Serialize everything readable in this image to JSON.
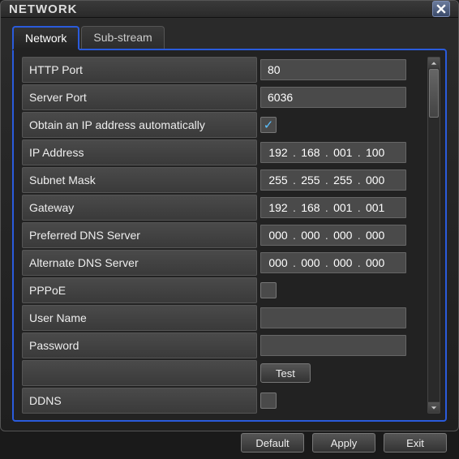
{
  "window": {
    "title": "NETWORK"
  },
  "tabs": [
    {
      "label": "Network",
      "active": true
    },
    {
      "label": "Sub-stream",
      "active": false
    }
  ],
  "fields": {
    "http_port": {
      "label": "HTTP Port",
      "value": "80"
    },
    "server_port": {
      "label": "Server Port",
      "value": "6036"
    },
    "dhcp": {
      "label": "Obtain an IP address automatically",
      "checked": true
    },
    "ip_address": {
      "label": "IP Address",
      "octets": [
        "192",
        "168",
        "001",
        "100"
      ]
    },
    "subnet_mask": {
      "label": "Subnet Mask",
      "octets": [
        "255",
        "255",
        "255",
        "000"
      ]
    },
    "gateway": {
      "label": "Gateway",
      "octets": [
        "192",
        "168",
        "001",
        "001"
      ]
    },
    "pref_dns": {
      "label": "Preferred DNS Server",
      "octets": [
        "000",
        "000",
        "000",
        "000"
      ]
    },
    "alt_dns": {
      "label": "Alternate DNS Server",
      "octets": [
        "000",
        "000",
        "000",
        "000"
      ]
    },
    "pppoe": {
      "label": "PPPoE",
      "checked": false
    },
    "user_name": {
      "label": "User Name",
      "value": ""
    },
    "password": {
      "label": "Password",
      "value": ""
    },
    "test": {
      "label": "",
      "button": "Test"
    },
    "ddns": {
      "label": "DDNS",
      "checked": false
    }
  },
  "buttons": {
    "default": "Default",
    "apply": "Apply",
    "exit": "Exit"
  }
}
